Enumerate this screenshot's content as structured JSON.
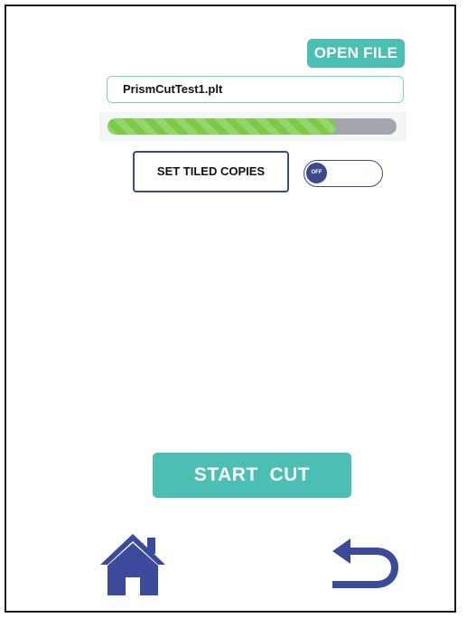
{
  "toolbar": {
    "open_file_label": "OPEN FILE"
  },
  "file": {
    "name": "PrismCutTest1.plt",
    "progress_percent": 79
  },
  "tiled": {
    "label": "SET TILED COPIES",
    "toggle_text": "OFF",
    "toggle_state": "off"
  },
  "actions": {
    "start_label": "START  CUT"
  },
  "nav": {
    "home_icon": "home-icon",
    "back_icon": "back-arrow-icon"
  },
  "colors": {
    "accent_teal": "#4bbfb4",
    "navy": "#3a4a8d",
    "progress_green": "#7bcb47",
    "progress_track": "#a3a6ad",
    "icon_blue": "#3b4a9a"
  }
}
